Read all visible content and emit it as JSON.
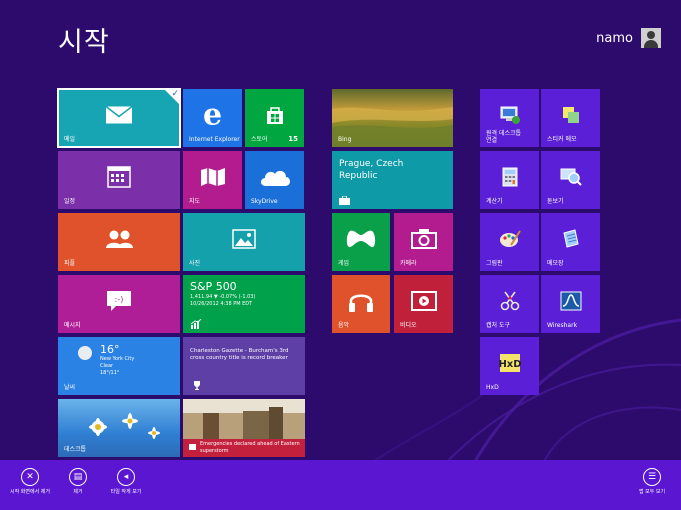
{
  "header": {
    "title": "시작",
    "user_name": "namo"
  },
  "tiles": {
    "mail": {
      "label": "메일"
    },
    "ie": {
      "label": "Internet Explorer"
    },
    "store": {
      "label": "스토어",
      "badge": "15"
    },
    "calendar": {
      "label": "일정"
    },
    "maps": {
      "label": "지도"
    },
    "skydrive": {
      "label": "SkyDrive"
    },
    "people": {
      "label": "피플"
    },
    "photos": {
      "label": "사진"
    },
    "messaging": {
      "label": "메시지"
    },
    "finance": {
      "title": "S&P 500",
      "line1": "1,411.94 ▼ -0.07% (-1.03)",
      "line2": "10/26/2012 4:38 PM EDT"
    },
    "weather": {
      "temp": "16°",
      "city": "New York City",
      "cond": "Clear",
      "range": "18°/11°",
      "label": "날씨"
    },
    "sports": {
      "text": "Charleston Gazette - Burcham's 3rd cross country title is record breaker"
    },
    "desktop": {
      "label": "데스크톱"
    },
    "news": {
      "text": "Emergencies declared ahead of Eastern superstorm"
    },
    "bing": {
      "label": "Bing"
    },
    "travel": {
      "text": "Prague, Czech Republic"
    },
    "games": {
      "label": "게임"
    },
    "camera": {
      "label": "카메라"
    },
    "music": {
      "label": "음악"
    },
    "video": {
      "label": "비디오"
    },
    "remote": {
      "label": "원격 데스크톱 연결"
    },
    "sticky": {
      "label": "스티커 메모"
    },
    "calculator": {
      "label": "계산기"
    },
    "magnifier": {
      "label": "돋보기"
    },
    "paint": {
      "label": "그림판"
    },
    "notepad": {
      "label": "메모장"
    },
    "snipping": {
      "label": "캡처 도구"
    },
    "wireshark": {
      "label": "Wireshark"
    },
    "hxd": {
      "label": "HxD"
    }
  },
  "appbar": {
    "unpin": "시작 화면에서 제거",
    "uninstall": "제거",
    "smaller": "타일 작게 보기",
    "all_apps": "앱 모두 보기"
  },
  "colors": {
    "background": "#2d0b6d",
    "appbar": "#5b16d2"
  }
}
